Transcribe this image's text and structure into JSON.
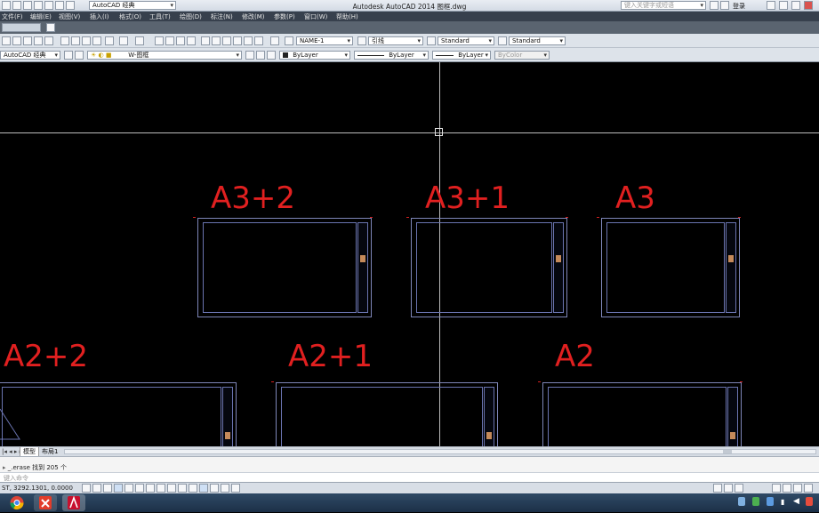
{
  "titlebar": {
    "workspace": "AutoCAD 经典",
    "title": "Autodesk AutoCAD 2014    图框.dwg",
    "search_placeholder": "键入关键字或短语",
    "login": "登录"
  },
  "menu": [
    "文件(F)",
    "编辑(E)",
    "视图(V)",
    "插入(I)",
    "格式(O)",
    "工具(T)",
    "绘图(D)",
    "标注(N)",
    "修改(M)",
    "参数(P)",
    "窗口(W)",
    "帮助(H)"
  ],
  "toolbar1": {
    "text_style": "NAME-1",
    "dim_style": "引线",
    "table_style": "Standard",
    "mleader_style": "Standard"
  },
  "toolbar2": {
    "workspace": "AutoCAD 经典",
    "layer": "W-图框",
    "color": "ByLayer",
    "linetype": "ByLayer",
    "lineweight": "ByLayer",
    "plotstyle": "ByColor"
  },
  "drawing": {
    "labels": [
      "A3+2",
      "A3+1",
      "A3",
      "A2+2",
      "A2+1",
      "A2"
    ],
    "frame_color": "#7e86b8",
    "label_color": "#e12020"
  },
  "layout_tabs": [
    "模型",
    "布局1"
  ],
  "command": {
    "history": "_.erase 找到 205 个",
    "prompt": "键入命令"
  },
  "status": {
    "coords": "ST, 3292.1301, 0.0000"
  },
  "taskbar": {
    "apps": [
      "chrome",
      "xmind",
      "autocad"
    ]
  }
}
